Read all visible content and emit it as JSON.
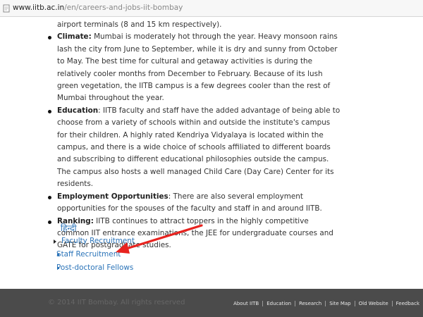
{
  "browser": {
    "url_host": "www.iitb.ac.in",
    "url_path": "/en/careers-and-jobs-iit-bombay"
  },
  "content": {
    "cont_text": "airport terminals (8 and 15 km respectively).",
    "items": [
      {
        "heading": "Climate:",
        "text": " Mumbai is moderately hot through the year. Heavy monsoon rains lash the city from June to September, while it is dry and sunny from October to May. The best time for cultural and getaway activities is during the relatively cooler months from December to February. Because of its lush green vegetation, the IITB campus is a few degrees cooler than the rest of Mumbai throughout the year."
      },
      {
        "heading": "Education",
        "text": ": IITB faculty and staff have the added advantage of being able to choose from a variety of schools  within and outside the institute's campus for their children. A highly rated Kendriya Vidyalaya is located within the campus, and there is a wide choice of schools affiliated to different boards and subscribing to different educational philosophies outside the campus. The campus also hosts a well managed Child Care (Day Care) Center for its residents."
      },
      {
        "heading": "Employment Opportunities",
        "text": ": There are also several employment opportunities for the spouses of the faculty and staff in and around IITB."
      },
      {
        "heading": "Ranking:",
        "text": " IITB continues to attract toppers in the highly competitive common IIT entrance examinations, the JEE for undergraduate courses and GATE for postgraduate studies."
      }
    ]
  },
  "hindi_link": "हिन्दी",
  "links": {
    "faculty": "Faculty Recruitment",
    "staff": "Staff Recruitment",
    "postdoc": "Post-doctoral Fellows"
  },
  "footer": {
    "copyright": "© 2014 IIT Bombay. All rights reserved",
    "nav": [
      "About IITB",
      "Education",
      "Research",
      "Site Map",
      "Old Website",
      "Feedback"
    ]
  },
  "colors": {
    "link": "#2a73b8",
    "arrow": "#e8231f",
    "footer_bg": "#4b4b4b"
  }
}
